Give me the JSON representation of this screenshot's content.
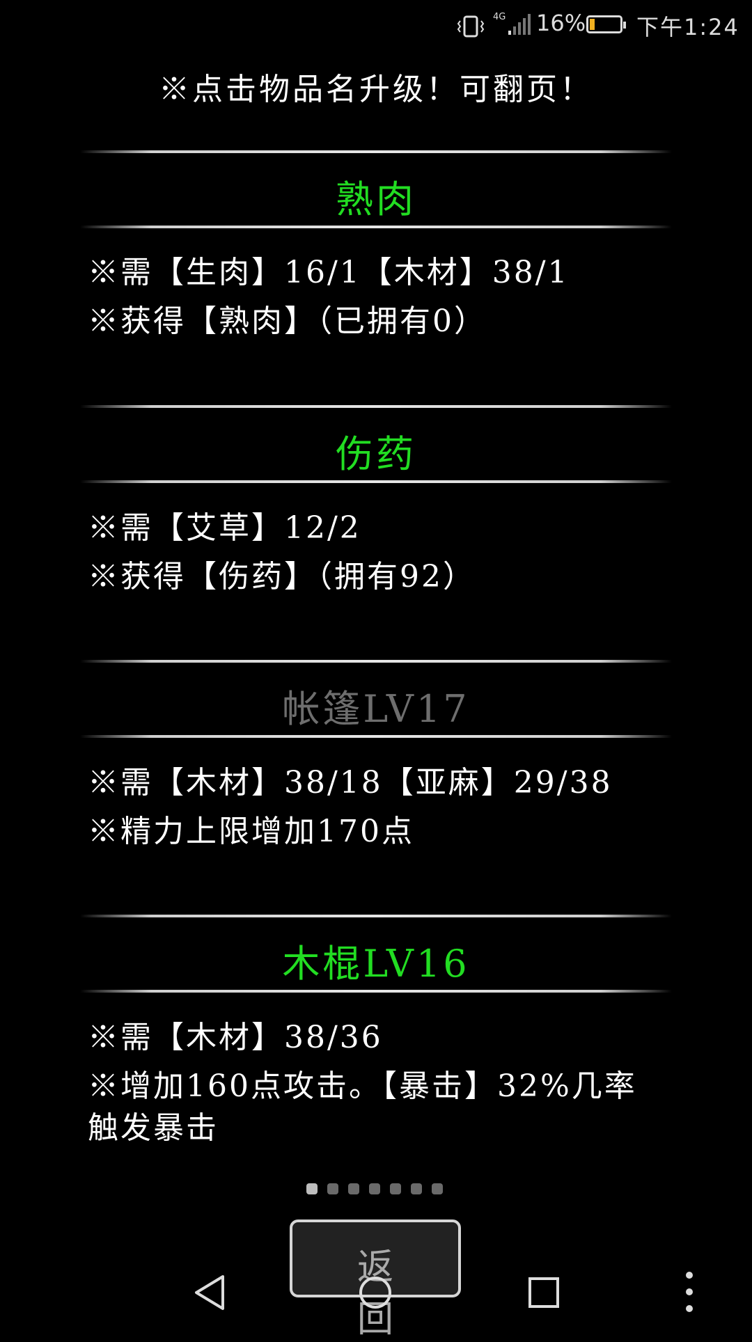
{
  "status_bar": {
    "network": "4G",
    "battery_percent": "16%",
    "battery_level": 0.16,
    "time": "下午1:24",
    "battery_color": "#f0b020"
  },
  "hint": "※点击物品名升级！可翻页！",
  "items": [
    {
      "title": "熟肉",
      "title_color": "#22dd22",
      "lines": [
        "※需【生肉】16/1【木材】38/1",
        "※获得【熟肉】（已拥有0）"
      ]
    },
    {
      "title": "伤药",
      "title_color": "#22dd22",
      "lines": [
        "※需【艾草】12/2",
        "※获得【伤药】（拥有92）"
      ]
    },
    {
      "title": "帐篷LV17",
      "title_color": "#6e6e6e",
      "lines": [
        "※需【木材】38/18【亚麻】29/38",
        "※精力上限增加170点"
      ]
    },
    {
      "title": "木棍LV16",
      "title_color": "#22dd22",
      "lines": [
        "※需【木材】38/36",
        "※增加160点攻击。【暴击】32%几率",
        "触发暴击"
      ]
    }
  ],
  "pagination": {
    "pages": 7,
    "current": 1
  },
  "back_button": {
    "label": "返回"
  },
  "nav_icons": [
    "back-triangle-icon",
    "home-circle-icon",
    "recents-square-icon",
    "more-vertical-icon"
  ]
}
